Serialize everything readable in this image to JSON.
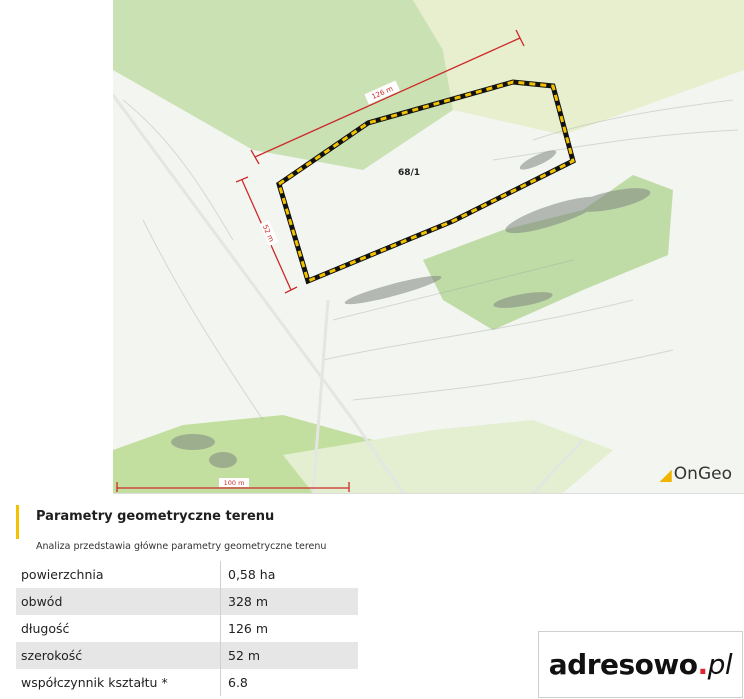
{
  "map": {
    "parcel_label": "68/1",
    "length_label": "126 m",
    "width_label": "52 m",
    "scale_label": "100 m",
    "brand": "OnGeo",
    "colors": {
      "parcel_outline": "#111111",
      "parcel_dash": "#f2c200",
      "measure_line": "#cc2a2a",
      "green": "#b7d89a"
    }
  },
  "section": {
    "title": "Parametry geometryczne terenu",
    "subtitle": "Analiza przedstawia główne parametry geometryczne terenu"
  },
  "params": [
    {
      "label": "powierzchnia",
      "value": "0,58 ha"
    },
    {
      "label": "obwód",
      "value": "328 m"
    },
    {
      "label": "długość",
      "value": "126 m"
    },
    {
      "label": "szerokość",
      "value": "52 m"
    },
    {
      "label": "współczynnik kształtu *",
      "value": "6.8"
    }
  ],
  "logo": {
    "name": "adresowo",
    "dot": ".",
    "tld": "pl"
  }
}
